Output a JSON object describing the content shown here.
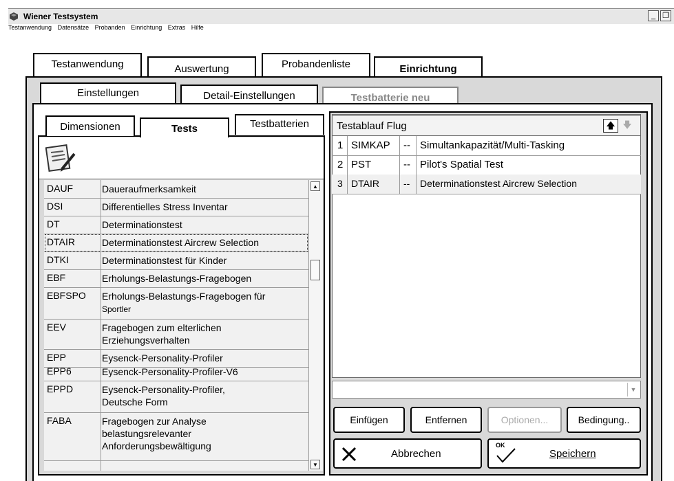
{
  "window": {
    "title": "Wiener Testsystem"
  },
  "menu": [
    "Testanwendung",
    "Datensätze",
    "Probanden",
    "Einrichtung",
    "Extras",
    "Hilfe"
  ],
  "main_tabs": [
    "Testanwendung",
    "Auswertung",
    "Probandenliste",
    "Einrichtung"
  ],
  "sub_tabs": [
    "Einstellungen",
    "Detail-Einstellungen",
    "Testbatterie neu"
  ],
  "inner_tabs": [
    "Dimensionen",
    "Tests",
    "Testbatterien"
  ],
  "tests": [
    {
      "code": "DAUF",
      "name": "Daueraufmerksamkeit"
    },
    {
      "code": "DSI",
      "name": "Differentielles Stress Inventar"
    },
    {
      "code": "DT",
      "name": "Determinationstest"
    },
    {
      "code": "DTAIR",
      "name": "Determinationstest Aircrew Selection"
    },
    {
      "code": "DTKI",
      "name": "Determinationstest für Kinder"
    },
    {
      "code": "EBF",
      "name": "Erholungs-Belastungs-Fragebogen"
    },
    {
      "code": "EBFSPO",
      "name": "Erholungs-Belastungs-Fragebogen für",
      "name2": "Sportler"
    },
    {
      "code": "EEV",
      "name": "Fragebogen zum elterlichen",
      "name2": "Erziehungsverhalten"
    },
    {
      "code": "EPP",
      "name": "Eysenck-Personality-Profiler"
    },
    {
      "code": "EPP6",
      "name": "Eysenck-Personality-Profiler-V6"
    },
    {
      "code": "EPPD",
      "name": "Eysenck-Personality-Profiler,",
      "name2": "Deutsche Form"
    },
    {
      "code": "FABA",
      "name": "Fragebogen zur Analyse",
      "name2": "belastungsrelevanter",
      "name3": "Anforderungsbewältigung"
    }
  ],
  "testablauf": {
    "title": "Testablauf Flug",
    "rows": [
      {
        "num": "1",
        "code": "SIMKAP",
        "sep": "--",
        "name": "Simultankapazität/Multi-Tasking"
      },
      {
        "num": "2",
        "code": "PST",
        "sep": "--",
        "name": "Pilot's Spatial Test"
      },
      {
        "num": "3",
        "code": "DTAIR",
        "sep": "--",
        "name": "Determinationstest Aircrew Selection"
      }
    ]
  },
  "buttons": {
    "einfuegen": "Einfügen",
    "entfernen": "Entfernen",
    "optionen": "Optionen...",
    "bedingung": "Bedingung..",
    "abbrechen": "Abbrechen",
    "speichern": "Speichern",
    "ok_badge": "OK"
  }
}
